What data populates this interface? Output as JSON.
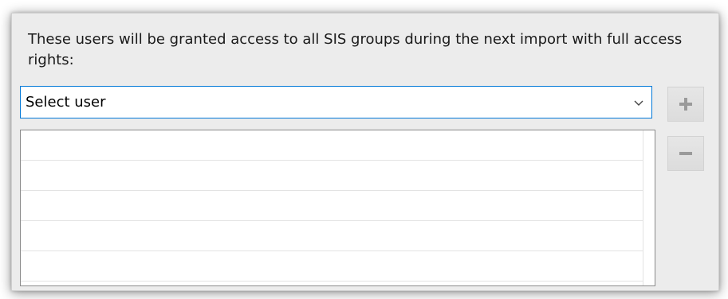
{
  "panel": {
    "description": "These users will be granted access to all SIS groups during the next import with full access rights:"
  },
  "user_select": {
    "selected_value": "Select user",
    "chevron_icon": "chevron-down-icon"
  },
  "buttons": {
    "add_icon": "plus-icon",
    "remove_icon": "minus-icon"
  },
  "user_list": {
    "rows": [
      "",
      "",
      "",
      "",
      ""
    ]
  },
  "colors": {
    "panel_background": "#ececec",
    "focus_border": "#0078d7",
    "button_glyph": "#9a9a9a"
  }
}
